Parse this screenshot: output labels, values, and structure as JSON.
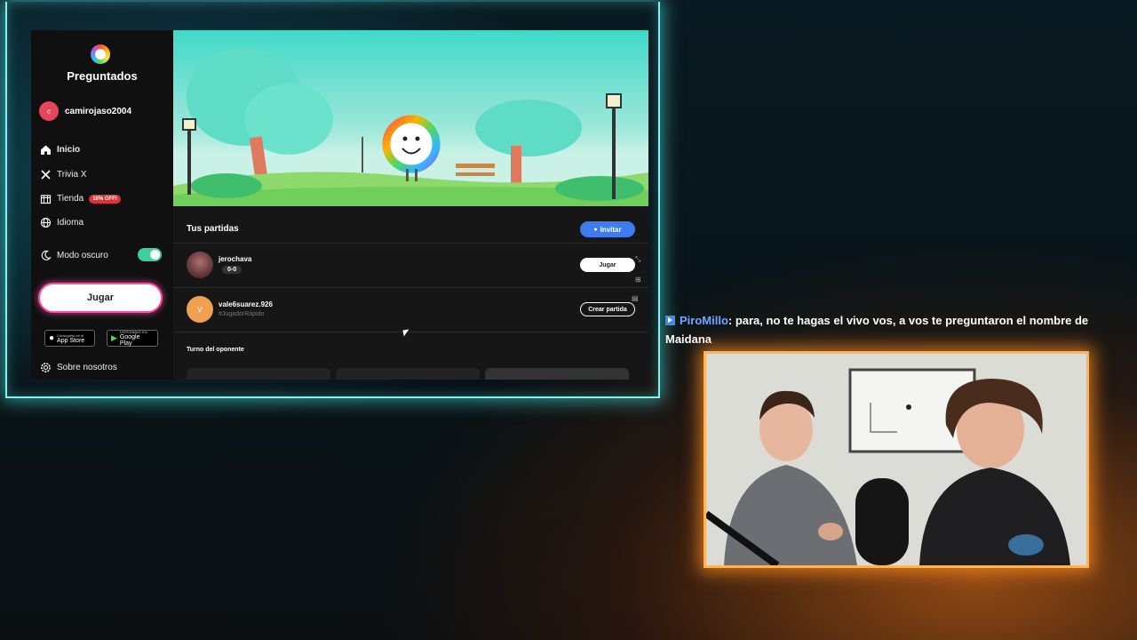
{
  "sidebar": {
    "brand": "Preguntados",
    "user": {
      "initial": "c",
      "name": "camirojaso2004"
    },
    "nav": [
      {
        "label": "Inicio",
        "icon": "home-icon"
      },
      {
        "label": "Trivia X",
        "icon": "crossed-swords-icon"
      },
      {
        "label": "Tienda",
        "icon": "store-icon",
        "badge": "10% OFF!"
      },
      {
        "label": "Idioma",
        "icon": "globe-icon"
      }
    ],
    "dark_mode": {
      "label": "Modo oscuro",
      "enabled": true
    },
    "play_label": "Jugar",
    "stores": {
      "appstore": {
        "small": "Consíguelo en el",
        "big": "App Store"
      },
      "googleplay": {
        "small": "DISPONIBLE EN",
        "big": "Google Play"
      }
    },
    "about_label": "Sobre nosotros"
  },
  "main": {
    "section_title": "Tus partidas",
    "invite_label": "Invitar",
    "games": [
      {
        "name": "jerochava",
        "score": "0-0",
        "action": "Jugar"
      },
      {
        "name": "vale6suarez.926",
        "tag": "#JugadorRápido",
        "avatar_initial": "V",
        "action": "Crear partida"
      }
    ],
    "opponent_turn_title": "Turno del oponente"
  },
  "chat": {
    "username": "PiroMillo",
    "message": ": para, no te hagas el vivo vos, a vos te preguntaron el nombre de Maidana"
  },
  "colors": {
    "accent_blue": "#3d7bef",
    "toggle_green": "#3ecf9f",
    "avatar_red": "#e8455d",
    "avatar_orange": "#f0a050",
    "frame_cyan": "#7ef3f0",
    "frame_orange": "#ffb35a"
  }
}
